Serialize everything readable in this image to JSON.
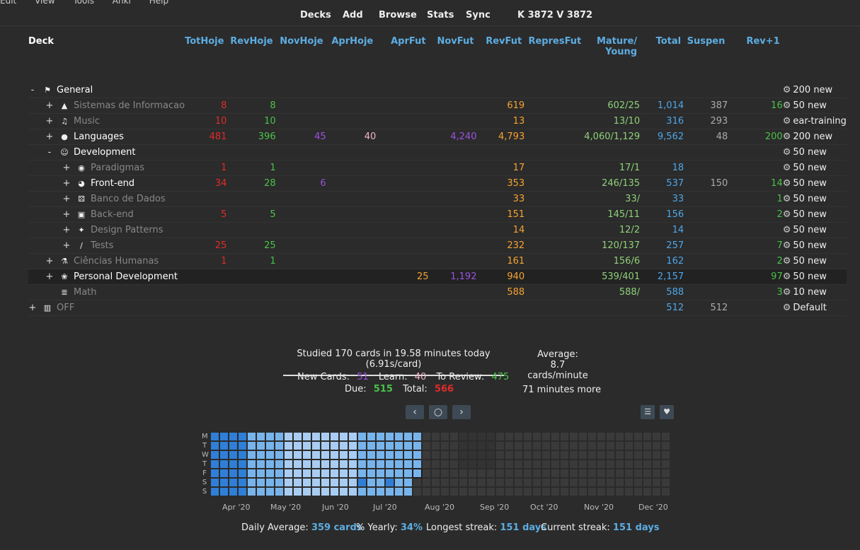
{
  "menu": [
    "Edit",
    "View",
    "Tools",
    "Anki",
    "Help"
  ],
  "toolbar": {
    "decks": "Decks",
    "add": "Add",
    "browse": "Browse",
    "stats": "Stats",
    "sync": "Sync",
    "counter": "K 3872 V 3872"
  },
  "columns": [
    "Deck",
    "TotHoje",
    "RevHoje",
    "NovHoje",
    "AprHoje",
    "AprFut",
    "NovFut",
    "RevFut",
    "RepresFut",
    "Mature/\nYoung",
    "Total",
    "Suspen",
    "Rev+1"
  ],
  "rows": [
    {
      "level": 0,
      "exp": "-",
      "icon": "flag-icon",
      "glyph": "⚑",
      "name": "General",
      "style": "bright",
      "tot": "",
      "rev": "",
      "nov": "",
      "apr": "",
      "aprf": "",
      "novf": "",
      "revf": "",
      "repf": "",
      "mat": "",
      "total": "",
      "susp": "",
      "revp": "",
      "opt": "200 new"
    },
    {
      "level": 1,
      "exp": "+",
      "icon": "graduation-cap-icon",
      "glyph": "▲",
      "name": "Sistemas de Informacao",
      "style": "dim",
      "tot": "8",
      "rev": "8",
      "nov": "",
      "apr": "",
      "aprf": "",
      "novf": "",
      "revf": "619",
      "repf": "",
      "mat": "602/25",
      "total": "1,014",
      "susp": "387",
      "revp": "16",
      "opt": "50 new"
    },
    {
      "level": 1,
      "exp": "+",
      "icon": "music-icon",
      "glyph": "♫",
      "name": "Music",
      "style": "dim",
      "tot": "10",
      "rev": "10",
      "nov": "",
      "apr": "",
      "aprf": "",
      "novf": "",
      "revf": "13",
      "repf": "",
      "mat": "13/10",
      "total": "316",
      "susp": "293",
      "revp": "",
      "opt": "ear-training"
    },
    {
      "level": 1,
      "exp": "+",
      "icon": "tongue-icon",
      "glyph": "●",
      "name": "Languages",
      "style": "bright",
      "tot": "481",
      "rev": "396",
      "nov": "45",
      "apr": "40",
      "aprf": "",
      "novf": "4,240",
      "revf": "4,793",
      "repf": "",
      "mat": "4,060/1,129",
      "total": "9,562",
      "susp": "48",
      "revp": "200",
      "opt": "200 new"
    },
    {
      "level": 1,
      "exp": "-",
      "icon": "developer-icon",
      "glyph": "☺",
      "name": "Development",
      "style": "bright",
      "tot": "",
      "rev": "",
      "nov": "",
      "apr": "",
      "aprf": "",
      "novf": "",
      "revf": "",
      "repf": "",
      "mat": "",
      "total": "",
      "susp": "",
      "revp": "",
      "opt": "50 new"
    },
    {
      "level": 2,
      "exp": "+",
      "icon": "paradigm-icon",
      "glyph": "◉",
      "name": "Paradigmas",
      "style": "dim",
      "tot": "1",
      "rev": "1",
      "nov": "",
      "apr": "",
      "aprf": "",
      "novf": "",
      "revf": "17",
      "repf": "",
      "mat": "17/1",
      "total": "18",
      "susp": "",
      "revp": "",
      "opt": "50 new"
    },
    {
      "level": 2,
      "exp": "+",
      "icon": "palette-icon",
      "glyph": "◕",
      "name": "Front-end",
      "style": "bright",
      "tot": "34",
      "rev": "28",
      "nov": "6",
      "apr": "",
      "aprf": "",
      "novf": "",
      "revf": "353",
      "repf": "",
      "mat": "246/135",
      "total": "537",
      "susp": "150",
      "revp": "14",
      "opt": "50 new"
    },
    {
      "level": 2,
      "exp": "+",
      "icon": "dice-icon",
      "glyph": "⚄",
      "name": "Banco de Dados",
      "style": "dim",
      "tot": "",
      "rev": "",
      "nov": "",
      "apr": "",
      "aprf": "",
      "novf": "",
      "revf": "33",
      "repf": "",
      "mat": "33/",
      "total": "33",
      "susp": "",
      "revp": "1",
      "opt": "50 new"
    },
    {
      "level": 2,
      "exp": "+",
      "icon": "server-icon",
      "glyph": "▣",
      "name": "Back-end",
      "style": "dim",
      "tot": "5",
      "rev": "5",
      "nov": "",
      "apr": "",
      "aprf": "",
      "novf": "",
      "revf": "151",
      "repf": "",
      "mat": "145/11",
      "total": "156",
      "susp": "",
      "revp": "2",
      "opt": "50 new"
    },
    {
      "level": 2,
      "exp": "+",
      "icon": "puzzle-icon",
      "glyph": "✦",
      "name": "Design Patterns",
      "style": "dim",
      "tot": "",
      "rev": "",
      "nov": "",
      "apr": "",
      "aprf": "",
      "novf": "",
      "revf": "14",
      "repf": "",
      "mat": "12/2",
      "total": "14",
      "susp": "",
      "revp": "",
      "opt": "50 new"
    },
    {
      "level": 2,
      "exp": "+",
      "icon": "test-tube-icon",
      "glyph": "∕",
      "name": "Tests",
      "style": "dim",
      "tot": "25",
      "rev": "25",
      "nov": "",
      "apr": "",
      "aprf": "",
      "novf": "",
      "revf": "232",
      "repf": "",
      "mat": "120/137",
      "total": "257",
      "susp": "",
      "revp": "7",
      "opt": "50 new"
    },
    {
      "level": 1,
      "exp": "+",
      "icon": "flask-icon",
      "glyph": "⚗",
      "name": "Ciências Humanas",
      "style": "dim",
      "tot": "1",
      "rev": "1",
      "nov": "",
      "apr": "",
      "aprf": "",
      "novf": "",
      "revf": "161",
      "repf": "",
      "mat": "156/6",
      "total": "162",
      "susp": "",
      "revp": "2",
      "opt": "50 new"
    },
    {
      "level": 1,
      "exp": "+",
      "icon": "brain-icon",
      "glyph": "❀",
      "name": "Personal Development",
      "style": "bright",
      "tot": "",
      "rev": "",
      "nov": "",
      "apr": "",
      "aprf": "25",
      "novf": "1,192",
      "revf": "940",
      "repf": "",
      "mat": "539/401",
      "total": "2,157",
      "susp": "",
      "revp": "97",
      "opt": "50 new",
      "hl": true
    },
    {
      "level": 1,
      "exp": "",
      "icon": "abacus-icon",
      "glyph": "≣",
      "name": "Math",
      "style": "dim",
      "tot": "",
      "rev": "",
      "nov": "",
      "apr": "",
      "aprf": "",
      "novf": "",
      "revf": "588",
      "repf": "",
      "mat": "588/",
      "total": "588",
      "susp": "",
      "revp": "3",
      "opt": "10 new"
    },
    {
      "level": 0,
      "exp": "+",
      "icon": "door-icon",
      "glyph": "▥",
      "name": "OFF",
      "style": "dim",
      "tot": "",
      "rev": "",
      "nov": "",
      "apr": "",
      "aprf": "",
      "novf": "",
      "revf": "",
      "repf": "",
      "mat": "",
      "total": "512",
      "susp": "512",
      "revp": "",
      "opt": "Default"
    }
  ],
  "summary": {
    "studied": "Studied 170 cards in 19.58 minutes today (6.91s/card)",
    "new_label": "New Cards:",
    "new_val": "51",
    "learn_label": "Learn:",
    "learn_val": "40",
    "review_label": "To Review:",
    "review_val": "475",
    "due_label": "Due:",
    "due_val": "515",
    "total_label": "Total:",
    "total_val": "566",
    "avg_label": "Average:",
    "avg_val": "8.7 cards/minute",
    "more": "71 minutes more"
  },
  "heatmap": {
    "days": [
      "M",
      "T",
      "W",
      "T",
      "F",
      "S",
      "S"
    ],
    "months": [
      "Apr '20",
      "May '20",
      "Jun '20",
      "Jul '20",
      "Aug '20",
      "Sep '20",
      "Oct '20",
      "Nov '20",
      "Dec '20"
    ],
    "colors": {
      "high": "#2f7fd8",
      "mid": "#78b4ec",
      "low": "#a9cdf2",
      "future": "#3a3a3a",
      "today_border": "#0a0a0a"
    }
  },
  "footer": {
    "daily_label": "Daily Average:",
    "daily_val": "359 cards",
    "yearly_label": "% Yearly:",
    "yearly_val": "34%",
    "longest_label": "Longest streak:",
    "longest_val": "151 days",
    "current_label": "Current streak:",
    "current_val": "151 days"
  }
}
